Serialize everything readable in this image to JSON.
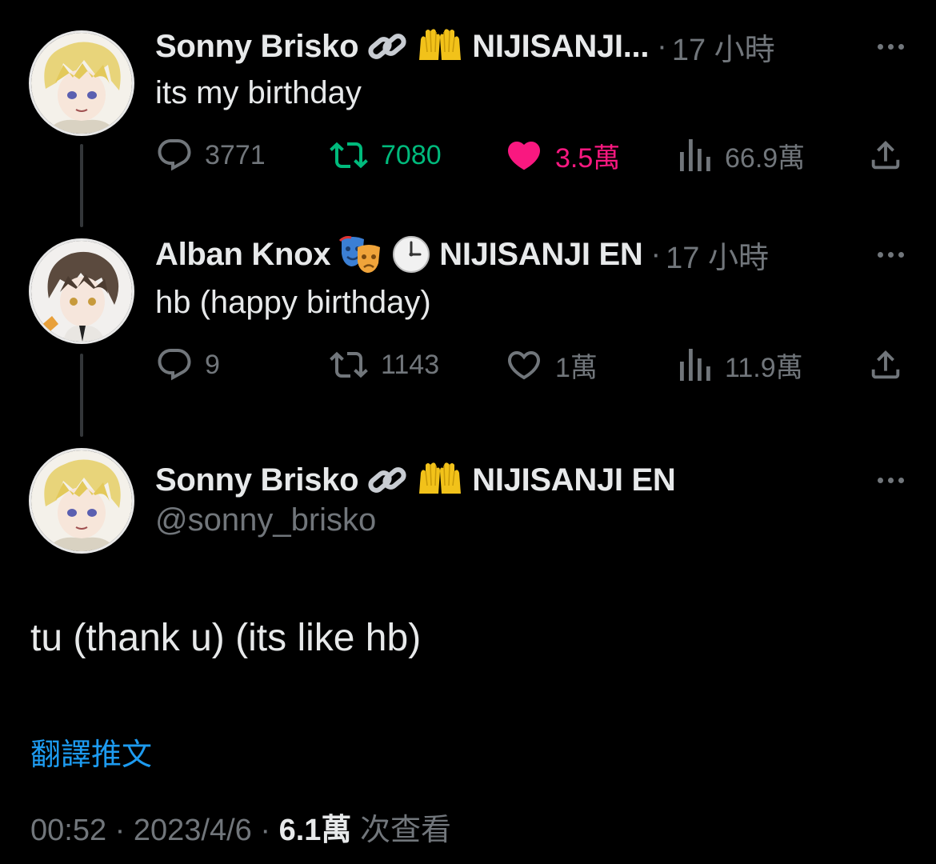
{
  "tweets": [
    {
      "name": "Sonny Brisko",
      "emoji_icons": [
        "link-icon",
        "raising-hands-icon"
      ],
      "affiliation": "NIJISANJI...",
      "separator": "·",
      "time": "17 小時",
      "text": "its my birthday",
      "replies": "3771",
      "retweets": "7080",
      "likes": "3.5萬",
      "views": "66.9萬",
      "liked": true,
      "retweeted": true
    },
    {
      "name": "Alban Knox",
      "emoji_icons": [
        "performing-arts-icon",
        "clock-icon"
      ],
      "affiliation": "NIJISANJI EN",
      "separator": "·",
      "time": "17 小時",
      "text": "hb (happy birthday)",
      "replies": "9",
      "retweets": "1143",
      "likes": "1萬",
      "views": "11.9萬",
      "liked": false,
      "retweeted": false
    }
  ],
  "main_tweet": {
    "name": "Sonny Brisko",
    "emoji_icons": [
      "link-icon",
      "raising-hands-icon"
    ],
    "affiliation": "NIJISANJI EN",
    "handle": "@sonny_brisko",
    "text": "tu (thank u) (its like hb)",
    "translate": "翻譯推文",
    "time": "00:52",
    "sep1": "·",
    "date": "2023/4/6",
    "sep2": "·",
    "views": "6.1萬",
    "views_suffix": "次查看"
  },
  "colors": {
    "background": "#000000",
    "text": "#e7e9ea",
    "muted": "#71767b",
    "retweet_green": "#00ba7c",
    "like_pink": "#f91880",
    "link_blue": "#1d9bf0"
  }
}
